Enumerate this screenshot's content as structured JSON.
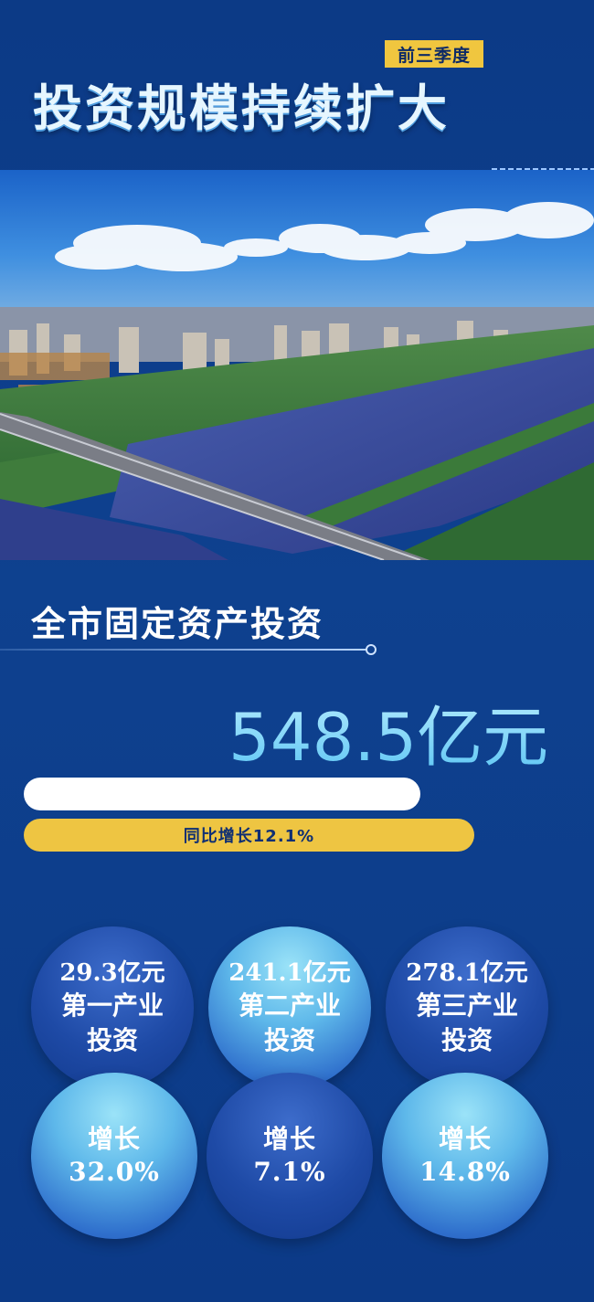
{
  "header": {
    "badge": "前三季度",
    "title": "投资规模持续扩大"
  },
  "section": {
    "title": "全市固定资产投资",
    "total": "548.5亿元",
    "yoy": "同比增长12.1%"
  },
  "industries": [
    {
      "amount": "29.3亿元",
      "name_line1": "第一产业",
      "name_line2": "投资",
      "growth_label": "增长",
      "growth": "32.0%"
    },
    {
      "amount": "241.1亿元",
      "name_line1": "第二产业",
      "name_line2": "投资",
      "growth_label": "增长",
      "growth": "7.1%"
    },
    {
      "amount": "278.1亿元",
      "name_line1": "第三产业",
      "name_line2": "投资",
      "growth_label": "增长",
      "growth": "14.8%"
    }
  ],
  "colors": {
    "background": "#0e418f",
    "accent_yellow": "#eec542",
    "number_cyan": "#7fd3ff"
  }
}
